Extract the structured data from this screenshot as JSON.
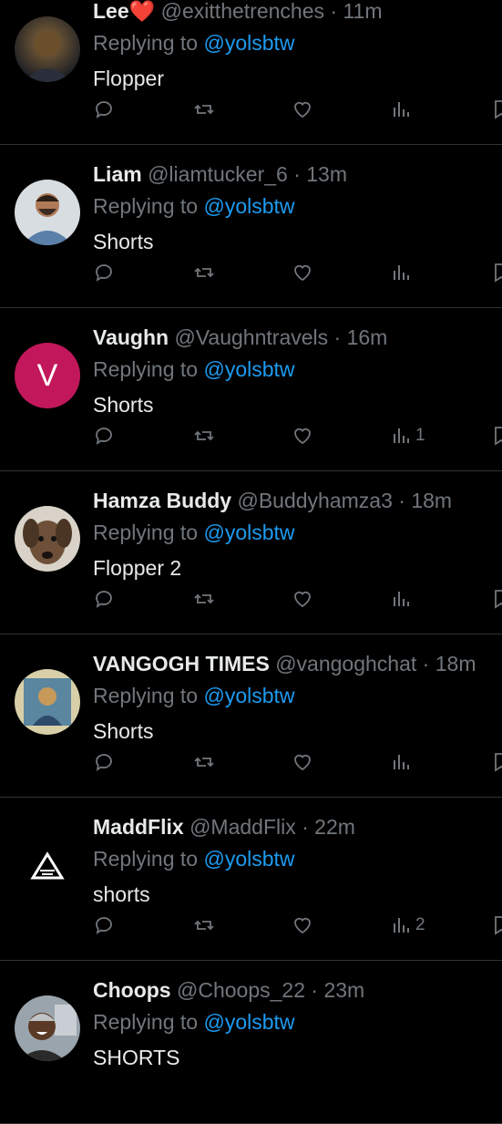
{
  "replying_prefix": "Replying to ",
  "mention": "@yolsbtw",
  "replies": [
    {
      "name": "Lee",
      "has_heart": true,
      "handle": "@exitthetrenches",
      "time": "11m",
      "text": "Flopper",
      "views": ""
    },
    {
      "name": "Liam",
      "has_heart": false,
      "handle": "@liamtucker_6",
      "time": "13m",
      "text": "Shorts",
      "views": ""
    },
    {
      "name": "Vaughn",
      "has_heart": false,
      "handle": "@Vaughntravels",
      "time": "16m",
      "text": "Shorts",
      "views": "1",
      "avatar_letter": "V"
    },
    {
      "name": "Hamza Buddy",
      "has_heart": false,
      "handle": "@Buddyhamza3",
      "time": "18m",
      "text": "Flopper 2",
      "views": ""
    },
    {
      "name": "VANGOGH TIMES",
      "has_heart": false,
      "handle": "@vangoghchat",
      "time": "18m",
      "text": "Shorts",
      "views": ""
    },
    {
      "name": "MaddFlix",
      "has_heart": false,
      "handle": "@MaddFlix",
      "time": "22m",
      "text": "shorts",
      "views": "2"
    },
    {
      "name": "Choops",
      "has_heart": false,
      "handle": "@Choops_22",
      "time": "23m",
      "text": "SHORTS",
      "views": ""
    }
  ],
  "colors": {
    "background": "#000000",
    "text": "#e7e9ea",
    "muted": "#71767b",
    "accent": "#1d9bf0",
    "heart": "#f91880"
  }
}
